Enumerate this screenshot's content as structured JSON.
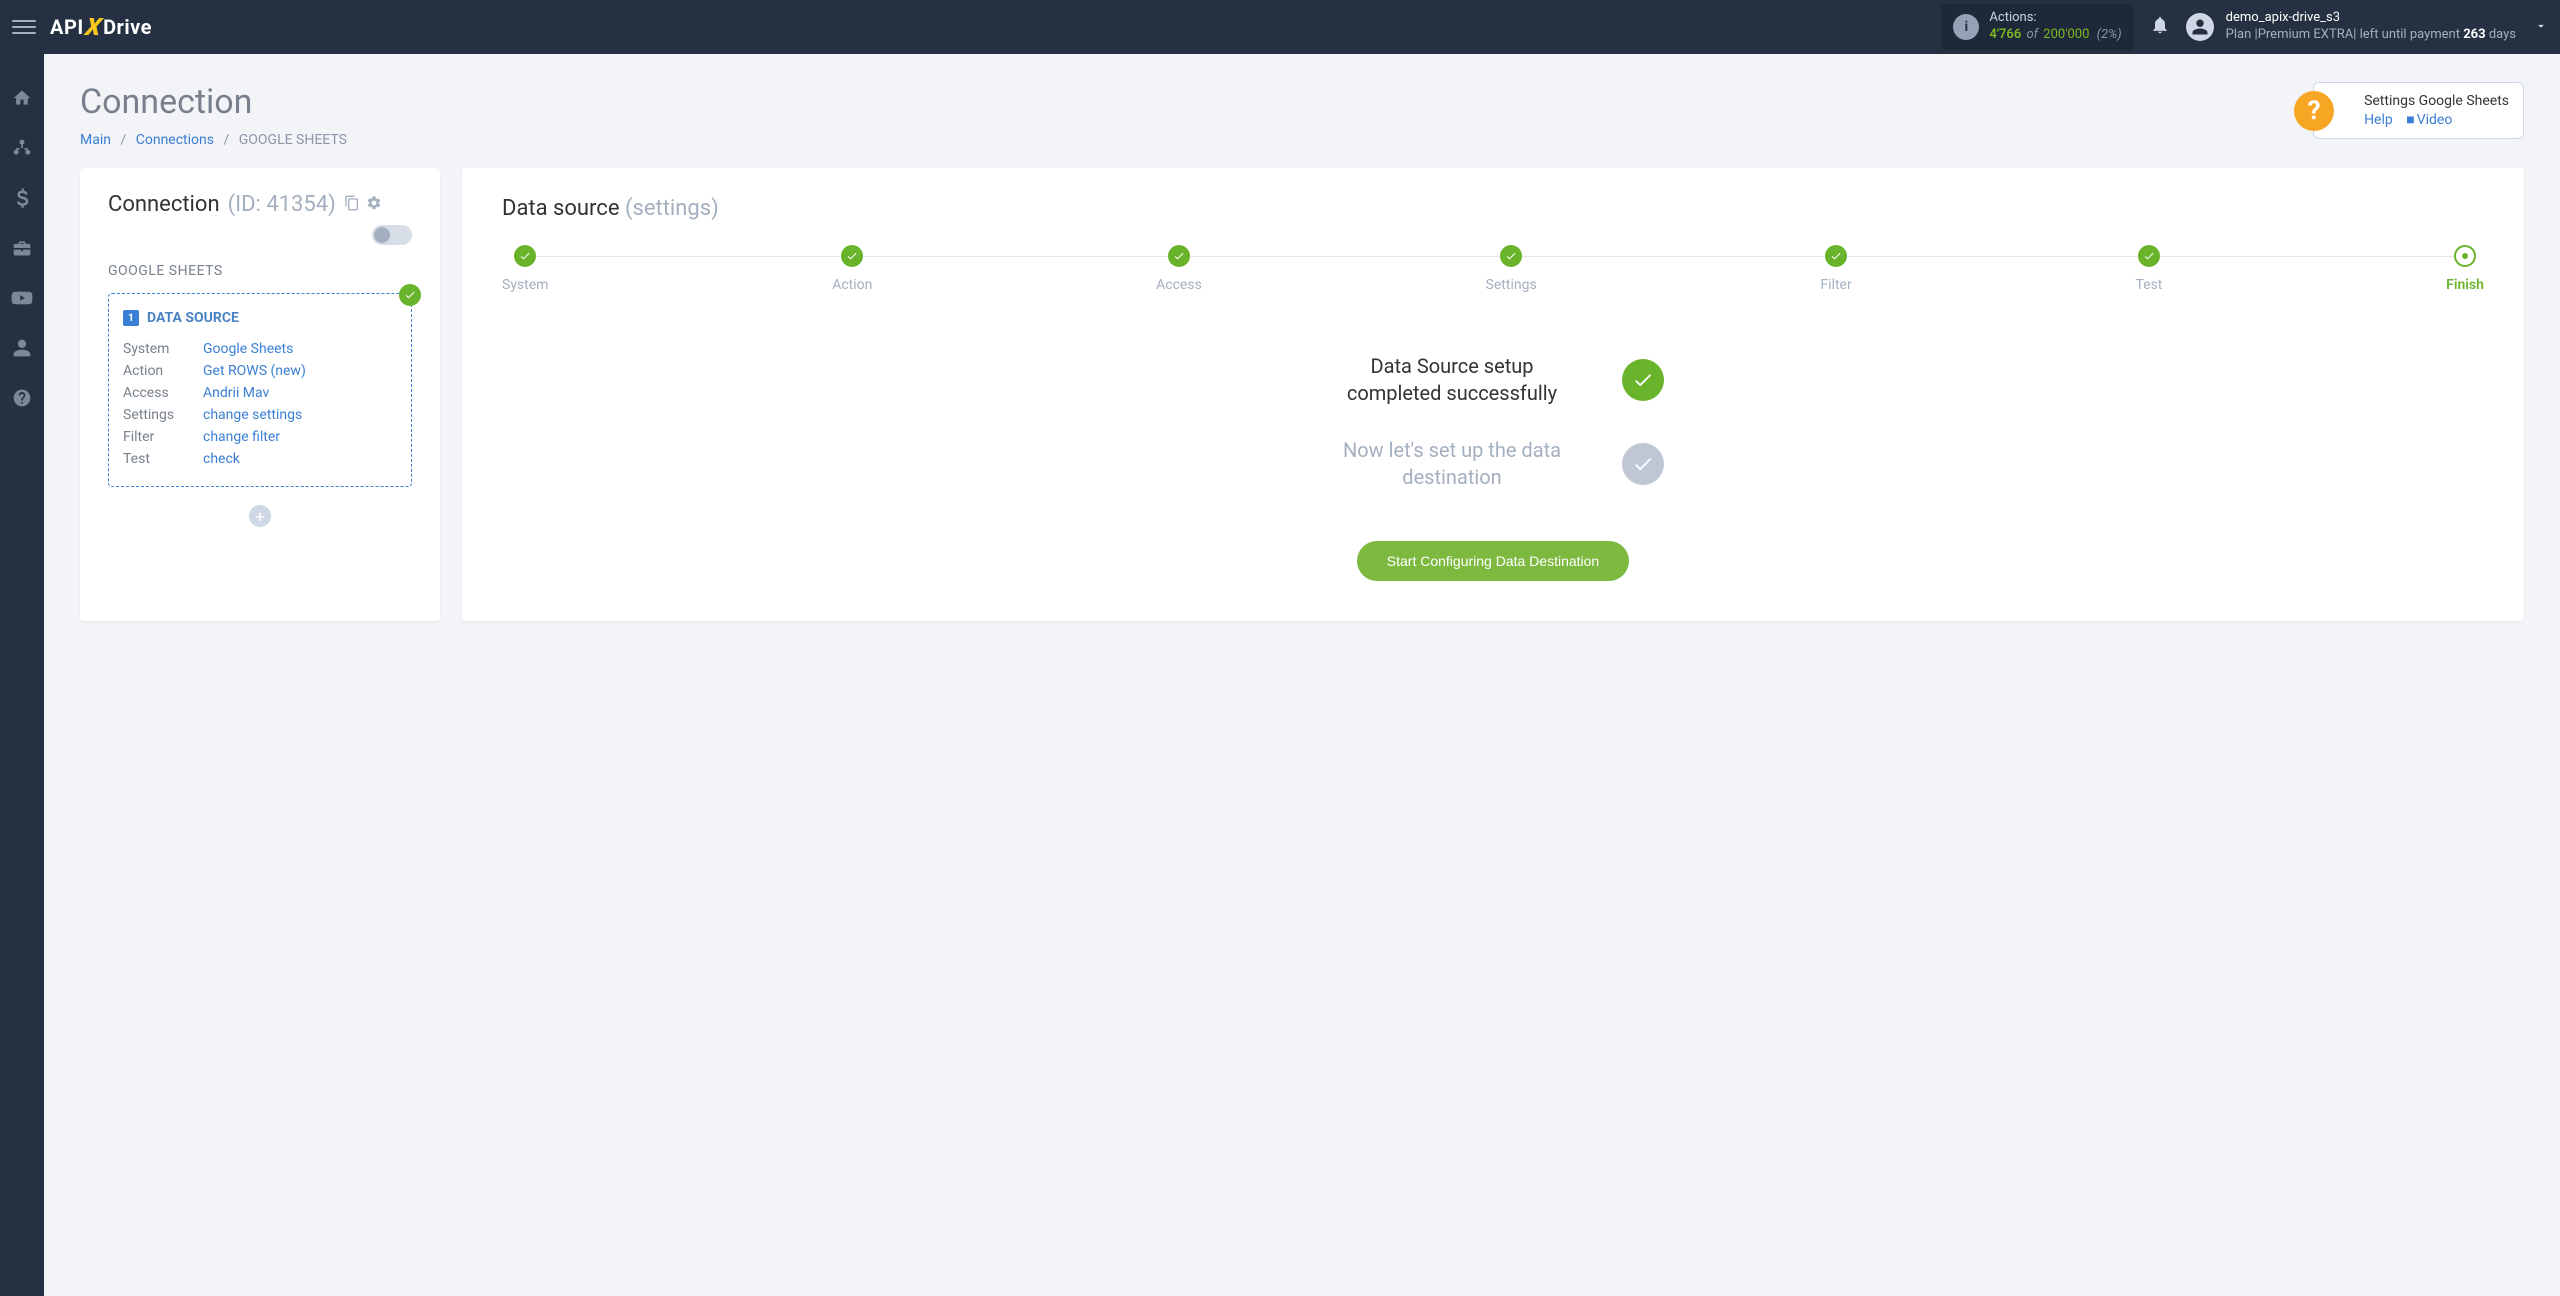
{
  "header": {
    "logo": {
      "api": "API",
      "x": "X",
      "drive": "Drive"
    },
    "actions": {
      "label": "Actions:",
      "used": "4'766",
      "of": "of",
      "total": "200'000",
      "pct": "(2%)"
    },
    "user": {
      "name": "demo_apix-drive_s3",
      "plan_prefix": "Plan |",
      "plan_name": "Premium EXTRA",
      "plan_mid": "| left until payment ",
      "days": "263",
      "days_suffix": " days"
    }
  },
  "page": {
    "title": "Connection",
    "breadcrumbs": {
      "main": "Main",
      "connections": "Connections",
      "current": "GOOGLE SHEETS"
    }
  },
  "help": {
    "title": "Settings Google Sheets",
    "help": "Help",
    "video": "Video"
  },
  "left": {
    "conn_label": "Connection",
    "conn_id": "(ID: 41354)",
    "subtitle": "GOOGLE SHEETS",
    "ds_badge": "1",
    "ds_title": "DATA SOURCE",
    "rows": {
      "system_k": "System",
      "system_v": "Google Sheets",
      "action_k": "Action",
      "action_v": "Get ROWS (new)",
      "access_k": "Access",
      "access_v": "Andrii Mav",
      "settings_k": "Settings",
      "settings_v": "change settings",
      "filter_k": "Filter",
      "filter_v": "change filter",
      "test_k": "Test",
      "test_v": "check"
    }
  },
  "right": {
    "title_main": "Data source",
    "title_sub": "(settings)",
    "steps": [
      "System",
      "Action",
      "Access",
      "Settings",
      "Filter",
      "Test",
      "Finish"
    ],
    "status1": "Data Source setup completed successfully",
    "status2": "Now let's set up the data destination",
    "cta": "Start Configuring Data Destination"
  }
}
